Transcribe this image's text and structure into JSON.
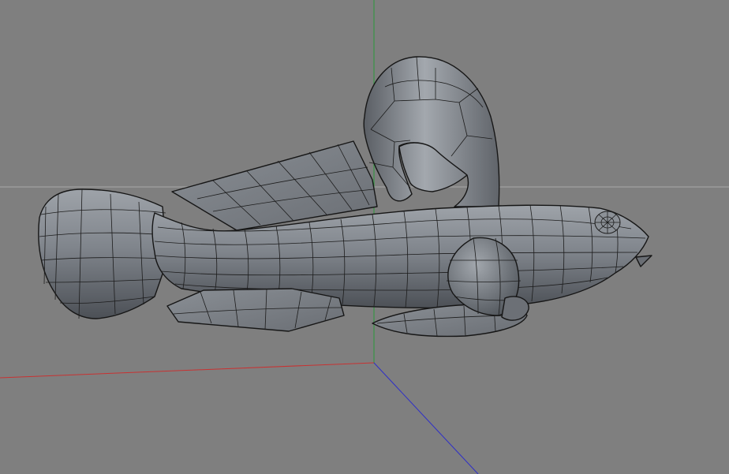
{
  "viewport": {
    "background_color": "#7f7f7f",
    "mesh_fill_color": "#7a7e84",
    "wire_color": "#1c1c1c",
    "axis_colors": {
      "x": "#c83232",
      "y": "#2a9a3a",
      "z": "#2e2ec8",
      "horizon": "#a8a8a8"
    },
    "object": "fish-mesh"
  }
}
